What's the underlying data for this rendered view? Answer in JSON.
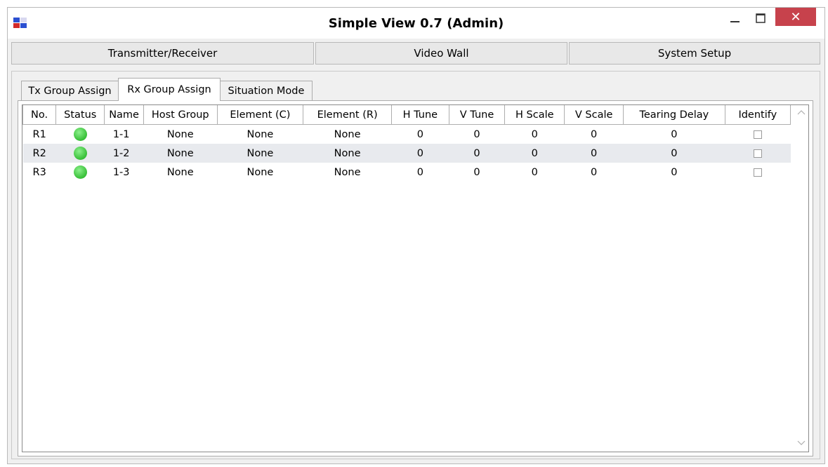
{
  "window": {
    "title": "Simple View 0.7 (Admin)"
  },
  "controls": {
    "minimize": "minimize-icon",
    "maximize": "maximize-icon",
    "close_label": "✕"
  },
  "nav": {
    "buttons": [
      "Transmitter/Receiver",
      "Video Wall",
      "System Setup"
    ]
  },
  "tabs": [
    "Tx Group Assign",
    "Rx Group Assign",
    "Situation Mode"
  ],
  "active_tab": "Rx Group Assign",
  "table": {
    "headers": [
      "No.",
      "Status",
      "Name",
      "Host Group",
      "Element (C)",
      "Element (R)",
      "H Tune",
      "V Tune",
      "H Scale",
      "V Scale",
      "Tearing Delay",
      "Identify"
    ],
    "rows": [
      {
        "no": "R1",
        "status": "online",
        "name": "1-1",
        "host_group": "None",
        "element_c": "None",
        "element_r": "None",
        "h_tune": "0",
        "v_tune": "0",
        "h_scale": "0",
        "v_scale": "0",
        "tearing_delay": "0",
        "identify": false
      },
      {
        "no": "R2",
        "status": "online",
        "name": "1-2",
        "host_group": "None",
        "element_c": "None",
        "element_r": "None",
        "h_tune": "0",
        "v_tune": "0",
        "h_scale": "0",
        "v_scale": "0",
        "tearing_delay": "0",
        "identify": false
      },
      {
        "no": "R3",
        "status": "online",
        "name": "1-3",
        "host_group": "None",
        "element_c": "None",
        "element_r": "None",
        "h_tune": "0",
        "v_tune": "0",
        "h_scale": "0",
        "v_scale": "0",
        "tearing_delay": "0",
        "identify": false
      }
    ]
  },
  "colors": {
    "status_online": "#3cc23c",
    "close_button": "#c7424c",
    "alt_row": "#e8eaee"
  }
}
